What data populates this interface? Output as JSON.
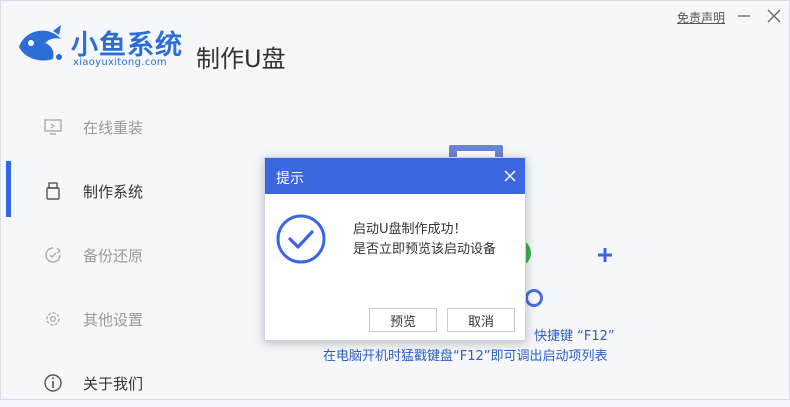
{
  "brand": {
    "name": "小鱼系统",
    "url": "xiaoyuxitong.com"
  },
  "header": {
    "page_title": "制作U盘",
    "disclaimer": "免责声明"
  },
  "sidebar": {
    "items": [
      {
        "label": "在线重装",
        "icon": "monitor-icon"
      },
      {
        "label": "制作系统",
        "icon": "usb-drive-icon",
        "active": true
      },
      {
        "label": "备份还原",
        "icon": "backup-icon"
      },
      {
        "label": "其他设置",
        "icon": "gear-icon"
      },
      {
        "label": "关于我们",
        "icon": "info-icon"
      }
    ]
  },
  "main": {
    "hint_line1": "快捷键 “F12”",
    "hint_line2": "在电脑开机时猛戳键盘“F12”即可调出启动项列表"
  },
  "dialog": {
    "title": "提示",
    "message_line1": "启动U盘制作成功！",
    "message_line2": "是否立即预览该启动设备",
    "preview_label": "预览",
    "cancel_label": "取消"
  },
  "colors": {
    "accent": "#2e68e6",
    "dialog_header": "#3b66e0",
    "brand": "#2b6fd6"
  }
}
